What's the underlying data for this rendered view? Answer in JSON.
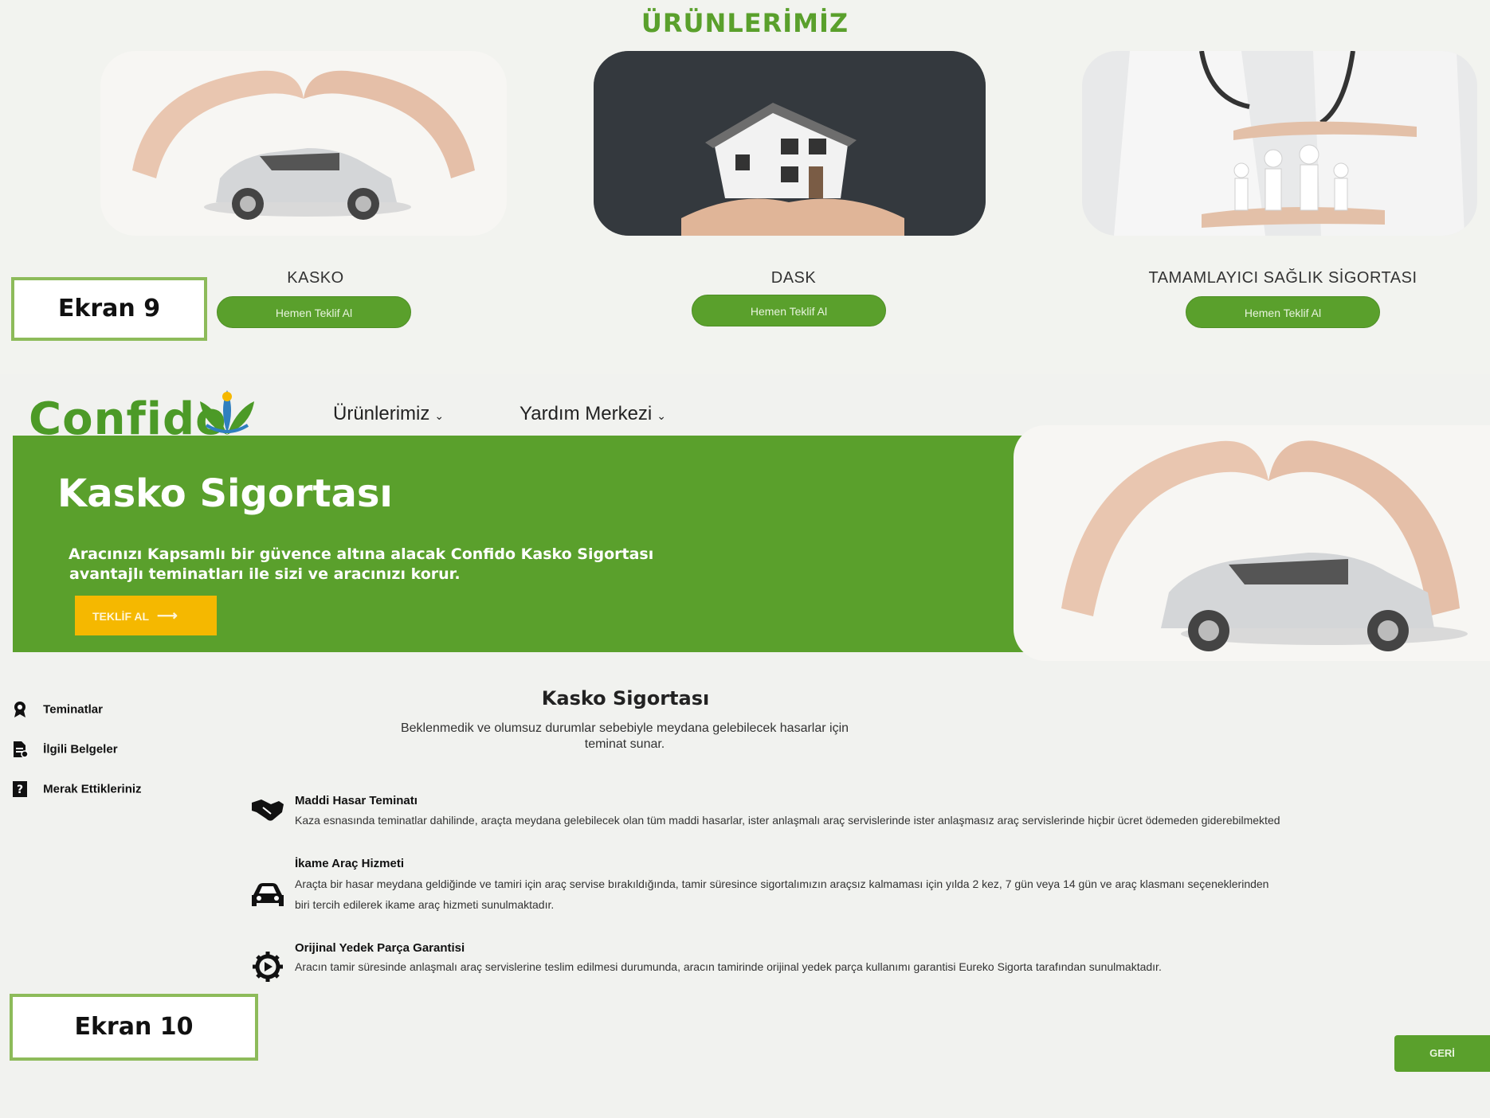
{
  "screen9": {
    "label": "Ekran 9",
    "section_title": "ÜRÜNLERİMİZ",
    "products": [
      {
        "name": "KASKO",
        "button": "Hemen Teklif Al",
        "image_icon": "car-protected-by-hands-image"
      },
      {
        "name": "DASK",
        "button": "Hemen Teklif Al",
        "image_icon": "house-in-hands-image"
      },
      {
        "name": "TAMAMLAYICI SAĞLIK SİGORTASI",
        "button": "Hemen Teklif Al",
        "image_icon": "family-under-doctor-hands-image"
      }
    ]
  },
  "screen10": {
    "label": "Ekran 10",
    "brand": "Confido",
    "nav": [
      {
        "label": "Ürünlerimiz"
      },
      {
        "label": "Yardım Merkezi"
      }
    ],
    "hero": {
      "title": "Kasko Sigortası",
      "subtitle_line1": "Aracınızı Kapsamlı bir güvence altına alacak Confido Kasko Sigortası",
      "subtitle_line2": "avantajlı teminatları ile sizi ve aracınızı korur.",
      "cta": "TEKLİF AL"
    },
    "sidebar": [
      {
        "label": "Teminatlar",
        "icon": "badge-icon"
      },
      {
        "label": "İlgili Belgeler",
        "icon": "document-icon"
      },
      {
        "label": "Merak Ettikleriniz",
        "icon": "question-book-icon"
      }
    ],
    "section": {
      "title": "Kasko Sigortası",
      "desc_line1": "Beklenmedik ve olumsuz durumlar sebebiyle meydana gelebilecek hasarlar için",
      "desc_line2": "teminat sunar."
    },
    "features": [
      {
        "title": "Maddi Hasar Teminatı",
        "lines": [
          "Kaza esnasında teminatlar dahilinde, araçta meydana gelebilecek olan tüm maddi hasarlar, ister anlaşmalı araç servislerinde ister anlaşmasız araç servislerinde hiçbir ücret ödemeden giderebilmekted"
        ],
        "icon": "handshake-icon"
      },
      {
        "title": "İkame Araç Hizmeti",
        "lines": [
          "Araçta bir hasar meydana geldiğinde ve tamiri için araç servise bırakıldığında, tamir süresince sigortalımızın araçsız kalmaması için yılda 2 kez, 7 gün veya 14 gün ve araç klasmanı seçeneklerinden",
          "biri tercih edilerek ikame araç hizmeti sunulmaktadır."
        ],
        "icon": "car-icon"
      },
      {
        "title": "Orijinal Yedek Parça Garantisi",
        "lines": [
          "Aracın tamir süresinde anlaşmalı araç servislerine teslim edilmesi durumunda, aracın tamirinde orijinal yedek parça kullanımı garantisi Eureko Sigorta tarafından sunulmaktadır."
        ],
        "icon": "gear-icon"
      }
    ],
    "back_button": "GERİ"
  },
  "colors": {
    "brand_green": "#5aa02c",
    "cta_yellow": "#f5b800",
    "box_border": "#8dbb5a"
  }
}
